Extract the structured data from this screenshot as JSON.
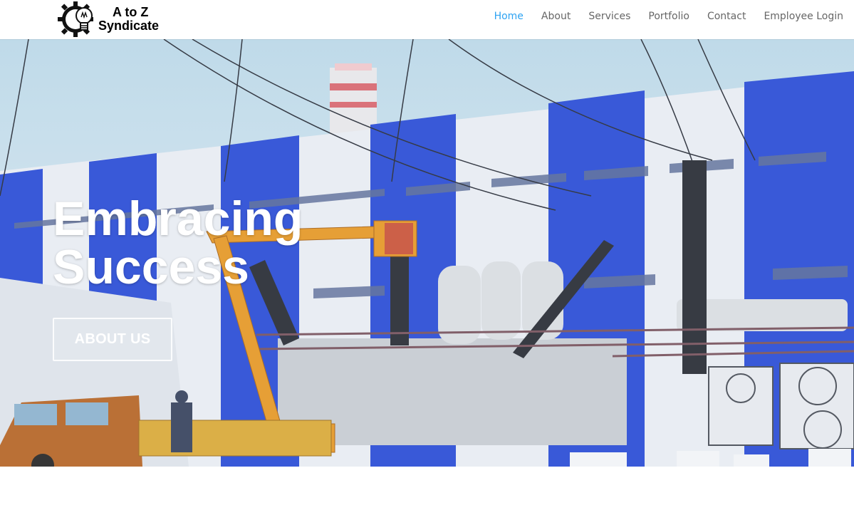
{
  "brand": {
    "line1": "A to Z",
    "line2": "Syndicate",
    "icon": "gear-bulb-logo-icon"
  },
  "nav": {
    "items": [
      {
        "label": "Home",
        "active": true
      },
      {
        "label": "About",
        "active": false
      },
      {
        "label": "Services",
        "active": false
      },
      {
        "label": "Portfolio",
        "active": false
      },
      {
        "label": "Contact",
        "active": false
      },
      {
        "label": "Employee Login",
        "active": false
      }
    ],
    "active_color": "#2ea3f2",
    "text_color": "#666666"
  },
  "hero": {
    "title_line1": "Embracing",
    "title_line2": "Success",
    "button_label": "ABOUT US"
  },
  "colors": {
    "building_blue": "#2d4fd6",
    "sky": "#cfe3ee",
    "crane_orange": "#e59a2a"
  }
}
